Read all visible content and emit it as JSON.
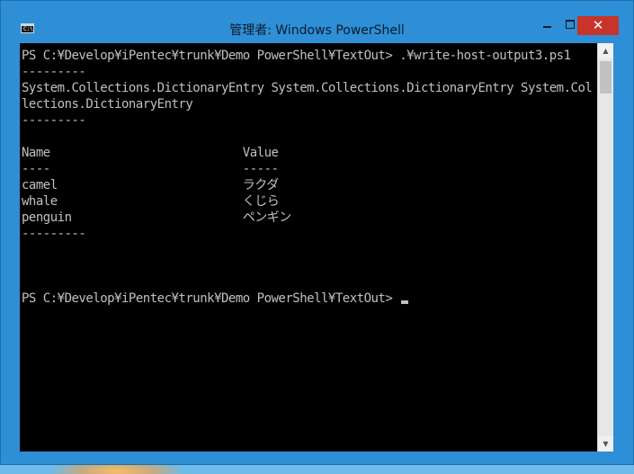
{
  "window": {
    "title": "管理者: Windows PowerShell",
    "icon": "powershell-console-icon",
    "icon_text": "C:\\",
    "controls": {
      "minimize_icon": "minimize-icon",
      "maximize_icon": "maximize-icon",
      "close_icon": "close-icon",
      "close_glyph": "✕"
    },
    "frame_color": "#2e8fd6",
    "close_color": "#c7342a"
  },
  "console": {
    "background": "#000000",
    "foreground": "#c0c0c0",
    "lines": [
      "PS C:¥Develop¥iPentec¥trunk¥Demo PowerShell¥TextOut> .¥write-host-output3.ps1",
      "---------",
      "System.Collections.DictionaryEntry System.Collections.DictionaryEntry System.Col",
      "lections.DictionaryEntry",
      "---------",
      "",
      "Name                           Value",
      "----                           -----",
      "camel                          ラクダ",
      "whale                          くじら",
      "penguin                        ペンギン",
      "---------",
      "",
      "",
      "",
      "PS C:¥Develop¥iPentec¥trunk¥Demo PowerShell¥TextOut> "
    ]
  },
  "scrollbar": {
    "up_arrow": "▲",
    "down_arrow": "▼"
  }
}
